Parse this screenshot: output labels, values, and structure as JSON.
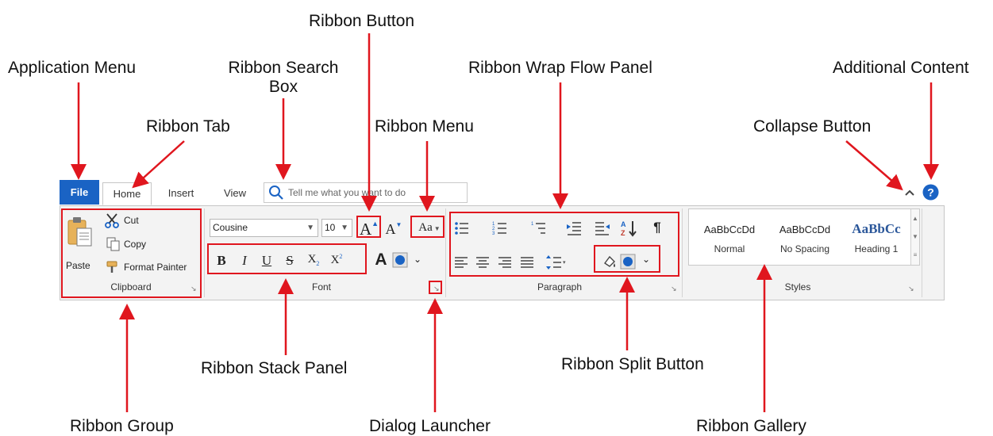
{
  "annotations": {
    "application_menu": "Application Menu",
    "ribbon_tab": "Ribbon Tab",
    "ribbon_search_box_line1": "Ribbon Search",
    "ribbon_search_box_line2": "Box",
    "ribbon_button": "Ribbon Button",
    "ribbon_menu": "Ribbon Menu",
    "ribbon_wrap_flow_panel": "Ribbon Wrap Flow Panel",
    "collapse_button": "Collapse Button",
    "additional_content": "Additional Content",
    "ribbon_group": "Ribbon Group",
    "ribbon_stack_panel": "Ribbon Stack Panel",
    "dialog_launcher": "Dialog Launcher",
    "ribbon_split_button": "Ribbon Split Button",
    "ribbon_gallery": "Ribbon Gallery"
  },
  "ribbon": {
    "tabs": {
      "file": "File",
      "home": "Home",
      "insert": "Insert",
      "view": "View"
    },
    "search_placeholder": "Tell me what you want to do",
    "clipboard": {
      "label": "Clipboard",
      "paste": "Paste",
      "cut": "Cut",
      "copy": "Copy",
      "format_painter": "Format Painter"
    },
    "font": {
      "label": "Font",
      "family": "Cousine",
      "size": "10",
      "grow": "A",
      "shrink": "A",
      "change_case": "Aa",
      "bold": "B",
      "italic": "I",
      "underline": "U",
      "strike": "S",
      "subscript_base": "X",
      "subscript_mark": "2",
      "superscript_base": "X",
      "superscript_mark": "2",
      "text_effect": "A"
    },
    "paragraph": {
      "label": "Paragraph",
      "sort": "AZ",
      "pilcrow": "¶"
    },
    "styles": {
      "label": "Styles",
      "items": [
        {
          "sample": "AaBbCcDd",
          "name": "Normal"
        },
        {
          "sample": "AaBbCcDd",
          "name": "No Spacing"
        },
        {
          "sample": "AaBbCc",
          "name": "Heading 1"
        }
      ]
    },
    "colors": {
      "file_tab": "#1a63c4",
      "highlight_box": "#e0161e",
      "help": "#1a63c4"
    },
    "icons": [
      "search-icon",
      "cut-icon",
      "copy-icon",
      "paste-icon",
      "format-painter-icon",
      "bullets-icon",
      "numbering-icon",
      "multilevel-list-icon",
      "indent-icon",
      "outdent-icon",
      "sort-icon",
      "align-left-icon",
      "align-center-icon",
      "align-right-icon",
      "justify-icon",
      "line-spacing-icon",
      "shading-icon",
      "collapse-icon",
      "help-icon"
    ]
  }
}
